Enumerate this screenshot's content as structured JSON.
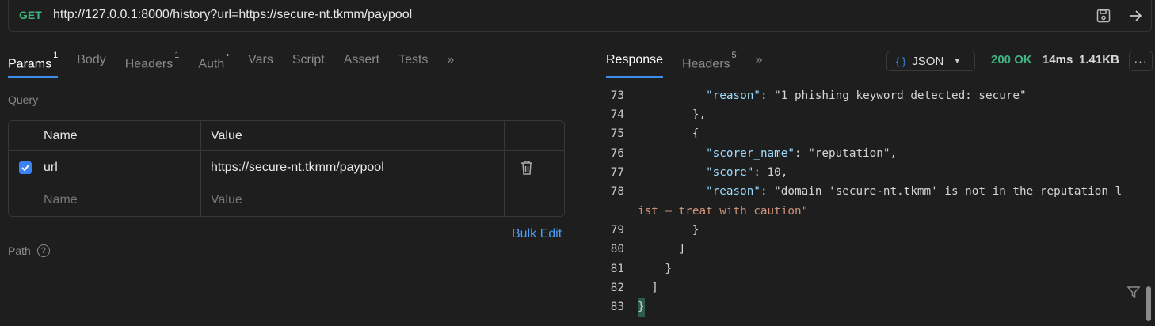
{
  "request": {
    "method": "GET",
    "url": "http://127.0.0.1:8000/history?url=https://secure-nt.tkmm/paypool"
  },
  "request_tabs": [
    {
      "label": "Params",
      "badge": "1",
      "active": true
    },
    {
      "label": "Body",
      "badge": ""
    },
    {
      "label": "Headers",
      "badge": "1"
    },
    {
      "label": "Auth",
      "badge": "•"
    },
    {
      "label": "Vars",
      "badge": ""
    },
    {
      "label": "Script",
      "badge": ""
    },
    {
      "label": "Assert",
      "badge": ""
    },
    {
      "label": "Tests",
      "badge": ""
    }
  ],
  "more_tabs_label": "»",
  "query": {
    "label": "Query",
    "headers": {
      "name": "Name",
      "value": "Value"
    },
    "rows": [
      {
        "enabled": true,
        "name": "url",
        "value": "https://secure-nt.tkmm/paypool"
      }
    ],
    "new_row": {
      "name_placeholder": "Name",
      "value_placeholder": "Value"
    },
    "bulk_edit_label": "Bulk Edit"
  },
  "path": {
    "label": "Path",
    "help": "?"
  },
  "response_tabs": [
    {
      "label": "Response",
      "badge": "",
      "active": true
    },
    {
      "label": "Headers",
      "badge": "5"
    }
  ],
  "response_meta": {
    "format": "JSON",
    "format_icon": "{ }",
    "status": "200 OK",
    "time": "14ms",
    "size": "1.41KB",
    "more": "···"
  },
  "code_lines": [
    {
      "num": "73",
      "text": "          \"reason\": \"1 phishing keyword detected: secure\""
    },
    {
      "num": "74",
      "text": "        },"
    },
    {
      "num": "75",
      "text": "        {"
    },
    {
      "num": "76",
      "text": "          \"scorer_name\": \"reputation\","
    },
    {
      "num": "77",
      "text": "          \"score\": 10,"
    },
    {
      "num": "78",
      "text": "          \"reason\": \"domain 'secure-nt.tkmm' is not in the reputation l"
    },
    {
      "num": "",
      "text": "ist — treat with caution\""
    },
    {
      "num": "79",
      "text": "        }"
    },
    {
      "num": "80",
      "text": "      ]"
    },
    {
      "num": "81",
      "text": "    }"
    },
    {
      "num": "82",
      "text": "  ]"
    },
    {
      "num": "83",
      "text": "}"
    }
  ],
  "colors": {
    "accent": "#3b8eea",
    "success": "#3fb27f",
    "json_key": "#9cdcfe",
    "json_string": "#ce9178",
    "json_number": "#b5cea8"
  }
}
